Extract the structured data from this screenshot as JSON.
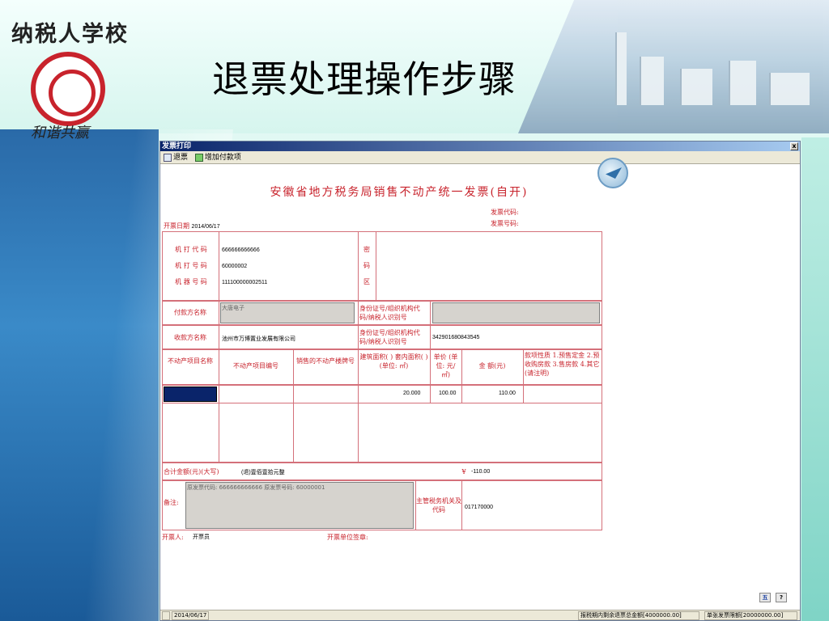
{
  "slide": {
    "school_name": "纳税人学校",
    "logo_caption": "和谐共赢",
    "title": "退票处理操作步骤"
  },
  "window": {
    "title": "发票打印",
    "close_label": "x",
    "toolbar": {
      "refund_label": "退票",
      "add_payment_label": "增加付款项"
    }
  },
  "invoice": {
    "title": "安徽省地方税务局销售不动产统一发票(自开)",
    "code_label": "发票代码:",
    "number_label": "发票号码:",
    "date_label": "开票日期",
    "date_value": "2014/06/17",
    "machine_code_label": "机 打 代 码",
    "machine_number_label": "机 打 号 码",
    "device_number_label": "机 器 号 码",
    "machine_code": "666666666666",
    "machine_number": "60000002",
    "device_number": "111100000002511",
    "secret_label_1": "密",
    "secret_label_2": "码",
    "secret_label_3": "区",
    "payer_label": "付款方名称",
    "payer_name": "大唐电子",
    "payer_id_label": "身份证号/组织机构代码/纳税人识别号",
    "payee_label": "收款方名称",
    "payee_name": "池州市万博置业发展有限公司",
    "payee_id_label": "身份证号/组织机构代码/纳税人识别号",
    "payee_id": "342901680843545",
    "col_project_name": "不动产项目名称",
    "col_project_no": "不动产项目编号",
    "col_sale_no": "销售的不动产楼牌号",
    "col_area": "建筑面积( ) 套内面积( ) (单位: ㎡)",
    "col_unit_price": "单价 (单位: 元/㎡)",
    "col_amount": "金  额(元)",
    "col_nature": "款项性质 1.预售定金 2.预收购房款 3.售房款 4.其它(请注明)",
    "row_area": "20.000",
    "row_unit_price": "100.00",
    "row_amount": "110.00",
    "total_label": "合计金额(元)(大写)",
    "total_words": "(退)壹佰壹拾元整",
    "total_symbol": "¥",
    "total_value": "-110.00",
    "remark_label": "备注:",
    "remark_text": "原发票代码: 666666666666  原发票号码: 60000001",
    "tax_office_label": "主管税务机关及代码",
    "tax_office_code": "017170000",
    "issuer_label": "开票人:",
    "issuer_value": "开票员",
    "issuer_sign_label": "开票单位签章:"
  },
  "statusbar": {
    "date": "2014/06/17",
    "remaining_refund": "报税期内剩余退票总金额[4000000.00]",
    "single_limit": "单张发票限额[20000000.00]"
  },
  "corner_buttons": {
    "btn1": "五",
    "btn2": "?"
  },
  "colors": {
    "invoice_red": "#c8232c",
    "titlebar_blue": "#0a246a"
  }
}
